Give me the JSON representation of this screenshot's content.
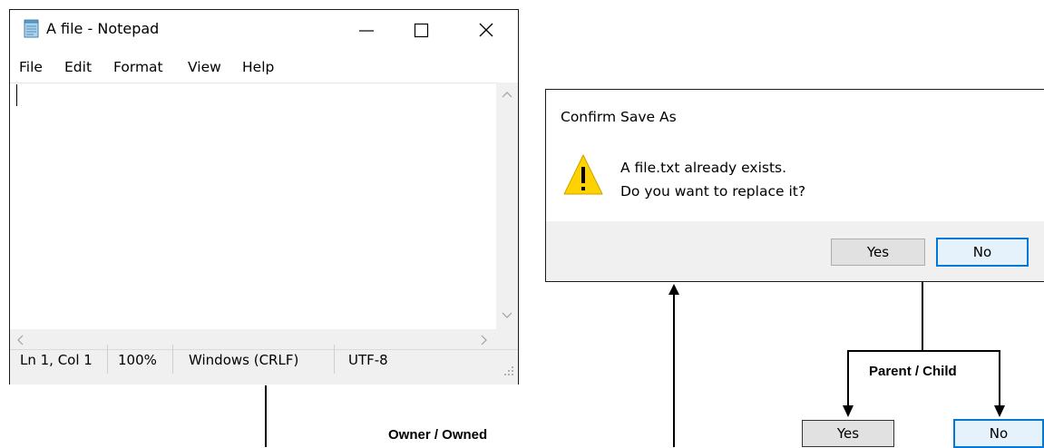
{
  "notepad": {
    "title": "A file - Notepad",
    "menu": [
      "File",
      "Edit",
      "Format",
      "View",
      "Help"
    ],
    "status": {
      "position": "Ln 1, Col 1",
      "zoom": "100%",
      "line_endings": "Windows (CRLF)",
      "encoding": "UTF-8"
    },
    "icons": {
      "app": "notepad-icon",
      "minimize": "minimize-icon",
      "maximize": "maximize-icon",
      "close": "close-icon"
    }
  },
  "dialog": {
    "title": "Confirm Save As",
    "message_line1": "A file.txt already exists.",
    "message_line2": "Do you want to replace it?",
    "icon": "warning-icon",
    "yes_label": "Yes",
    "no_label": "No"
  },
  "diagram": {
    "owner_label": "Owner / Owned",
    "parent_child_label": "Parent / Child",
    "child_yes_label": "Yes",
    "child_no_label": "No"
  },
  "colors": {
    "focus_border": "#0078d7",
    "focus_fill": "#e5f1fb",
    "warning_yellow": "#ffd200"
  }
}
